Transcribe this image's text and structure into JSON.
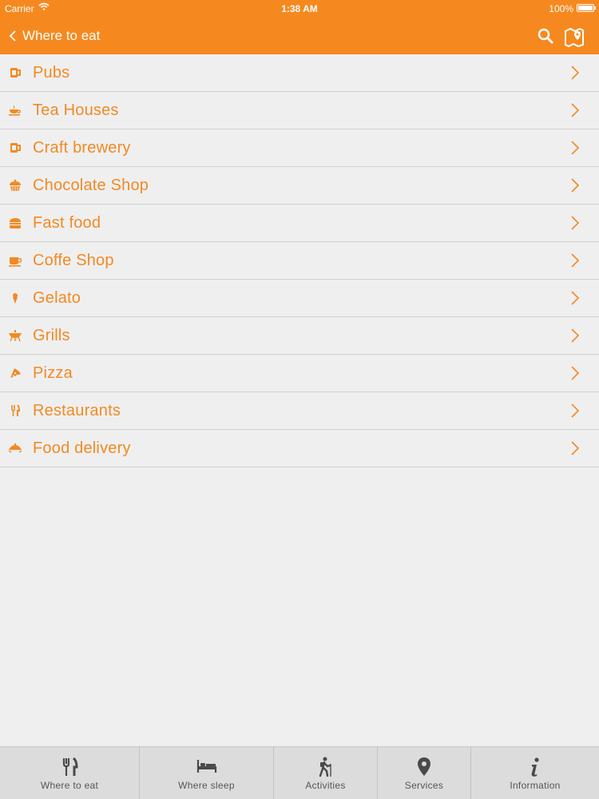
{
  "status_bar": {
    "carrier": "Carrier",
    "time": "1:38 AM",
    "battery": "100%"
  },
  "header": {
    "title": "Where to eat",
    "back_icon": "chevron-left-icon",
    "actions": [
      "search-icon",
      "map-icon"
    ]
  },
  "colors": {
    "accent": "#f5891f",
    "text_orange": "#f28a22",
    "background": "#efeff0",
    "tabbar": "#dcdcdd"
  },
  "list": {
    "items": [
      {
        "label": "Pubs",
        "icon": "beer-mug-icon"
      },
      {
        "label": "Tea Houses",
        "icon": "teacup-icon"
      },
      {
        "label": "Craft brewery",
        "icon": "beer-mug-icon"
      },
      {
        "label": "Chocolate Shop",
        "icon": "cupcake-icon"
      },
      {
        "label": "Fast food",
        "icon": "burger-icon"
      },
      {
        "label": "Coffe Shop",
        "icon": "coffee-cup-icon"
      },
      {
        "label": "Gelato",
        "icon": "ice-cream-icon"
      },
      {
        "label": "Grills",
        "icon": "grill-icon"
      },
      {
        "label": "Pizza",
        "icon": "pizza-slice-icon"
      },
      {
        "label": "Restaurants",
        "icon": "fork-knife-icon"
      },
      {
        "label": "Food delivery",
        "icon": "delivery-icon"
      }
    ]
  },
  "tabbar": {
    "tabs": [
      {
        "label": "Where to eat",
        "icon": "fork-knife-icon"
      },
      {
        "label": "Where sleep",
        "icon": "bed-icon"
      },
      {
        "label": "Activities",
        "icon": "hiker-icon"
      },
      {
        "label": "Services",
        "icon": "location-pin-icon"
      },
      {
        "label": "Information",
        "icon": "info-icon"
      }
    ]
  }
}
